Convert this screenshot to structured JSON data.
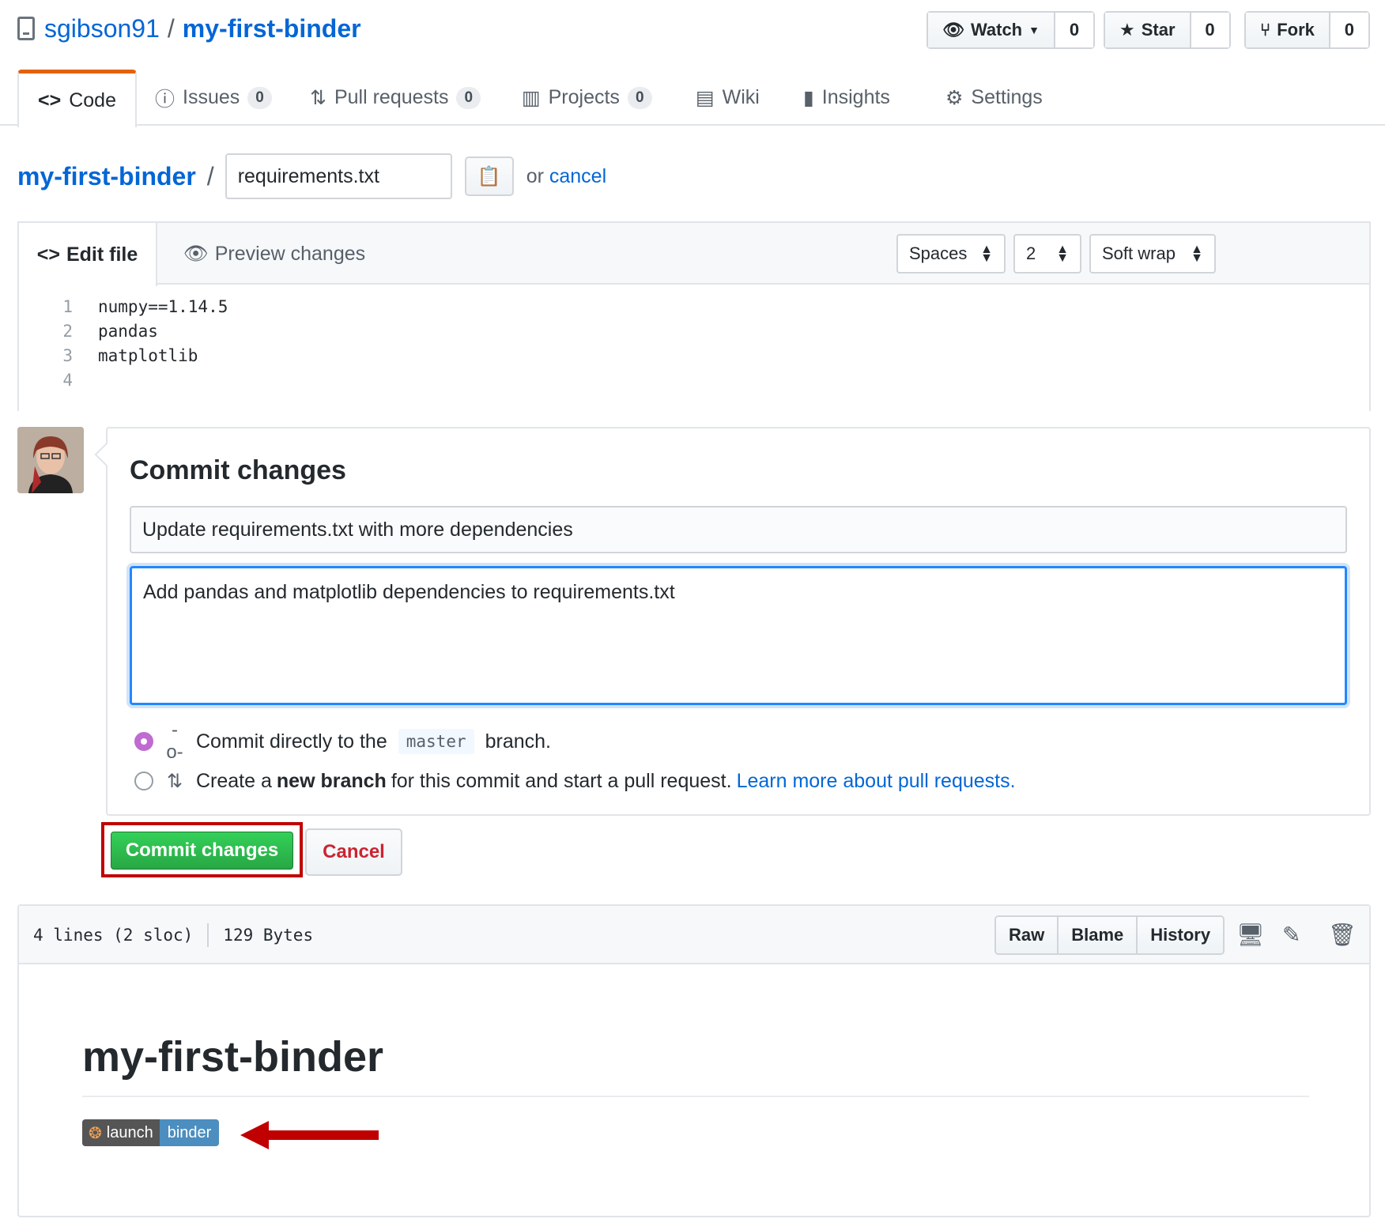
{
  "repo": {
    "owner": "sgibson91",
    "separator": "/",
    "name": "my-first-binder"
  },
  "header_buttons": {
    "watch": {
      "label": "Watch",
      "count": "0"
    },
    "star": {
      "label": "Star",
      "count": "0"
    },
    "fork": {
      "label": "Fork",
      "count": "0"
    }
  },
  "tabs": [
    {
      "label": "Code"
    },
    {
      "label": "Issues",
      "count": "0"
    },
    {
      "label": "Pull requests",
      "count": "0"
    },
    {
      "label": "Projects",
      "count": "0"
    },
    {
      "label": "Wiki"
    },
    {
      "label": "Insights"
    },
    {
      "label": "Settings"
    }
  ],
  "edit": {
    "root": "my-first-binder",
    "slash": "/",
    "filename": "requirements.txt",
    "or_text": "or",
    "cancel_link": "cancel"
  },
  "editor": {
    "edit_tab": "Edit file",
    "preview_tab": "Preview changes",
    "indent_mode": "Spaces",
    "indent_size": "2",
    "wrap_mode": "Soft wrap",
    "lines": [
      {
        "num": "1",
        "text": "numpy==1.14.5"
      },
      {
        "num": "2",
        "text": "pandas"
      },
      {
        "num": "3",
        "text": "matplotlib"
      },
      {
        "num": "4",
        "text": ""
      }
    ]
  },
  "commit": {
    "title": "Commit changes",
    "summary": "Update requirements.txt with more dependencies",
    "description": "Add pandas and matplotlib dependencies to requirements.txt",
    "option_direct": {
      "prefix": "Commit directly to the",
      "branch": "master",
      "suffix": "branch."
    },
    "option_branch": {
      "prefix": "Create a",
      "bold": "new branch",
      "suffix": "for this commit and start a pull request.",
      "link": "Learn more about pull requests."
    },
    "commit_button": "Commit changes",
    "cancel_button": "Cancel"
  },
  "file": {
    "lines_info": "4 lines (2 sloc)",
    "size": "129 Bytes",
    "buttons": {
      "raw": "Raw",
      "blame": "Blame",
      "history": "History"
    }
  },
  "readme": {
    "title": "my-first-binder",
    "badge_left": "launch",
    "badge_right": "binder"
  },
  "colors": {
    "link": "#0366d6",
    "tab_accent": "#e36209",
    "commit_green": "#28a745",
    "highlight_red": "#c00000",
    "badge_blue": "#4c8ebf"
  }
}
